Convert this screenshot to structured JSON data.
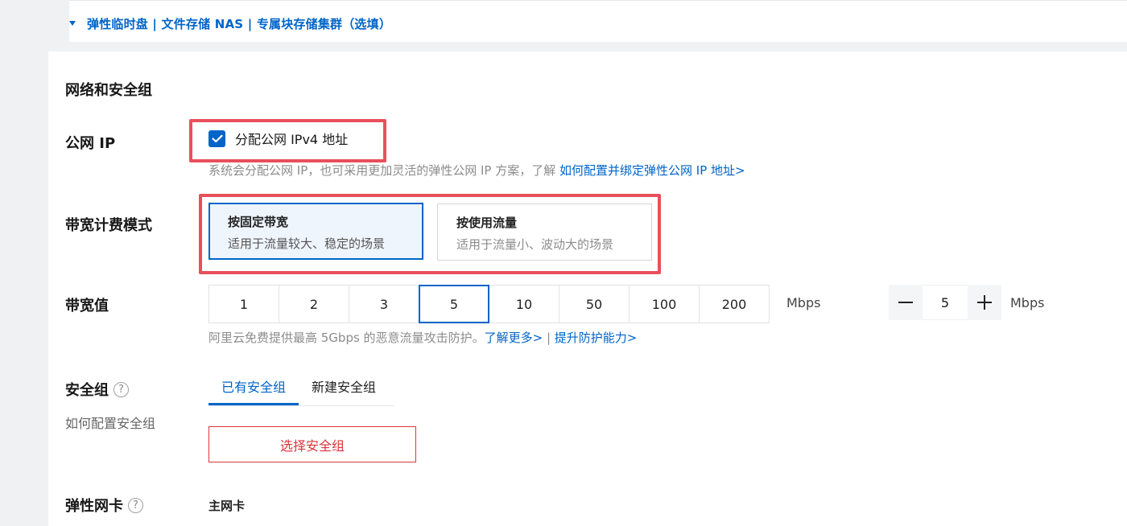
{
  "storage_toggle": {
    "label": "弹性临时盘 | 文件存储 NAS | 专属块存储集群（选填）"
  },
  "section_title": "网络和安全组",
  "public_ip": {
    "label": "公网 IP",
    "checkbox_label": "分配公网 IPv4 地址",
    "checked": true,
    "hint": "系统会分配公网 IP，也可采用更加灵活的弹性公网 IP 方案，了解",
    "hint_link": "如何配置并绑定弹性公网 IP 地址>"
  },
  "billing_mode": {
    "label": "带宽计费模式",
    "options": [
      {
        "title": "按固定带宽",
        "desc": "适用于流量较大、稳定的场景",
        "selected": true
      },
      {
        "title": "按使用流量",
        "desc": "适用于流量小、波动大的场景",
        "selected": false
      }
    ]
  },
  "bandwidth": {
    "label": "带宽值",
    "options": [
      "1",
      "2",
      "3",
      "5",
      "10",
      "50",
      "100",
      "200"
    ],
    "selected": "5",
    "unit": "Mbps",
    "stepper_value": "5",
    "stepper_unit": "Mbps",
    "hint": "阿里云免费提供最高 5Gbps 的恶意流量攻击防护。",
    "link_learn": "了解更多>",
    "separator": "|",
    "link_upgrade": "提升防护能力>"
  },
  "security_group": {
    "label": "安全组",
    "help": "?",
    "sublabel": "如何配置安全组",
    "tabs": [
      "已有安全组",
      "新建安全组"
    ],
    "active_tab": 0,
    "select_button": "选择安全组"
  },
  "eni": {
    "label": "弹性网卡",
    "help": "?",
    "primary": "主网卡"
  },
  "colors": {
    "accent": "#0064c8",
    "annotation": "#e8505b",
    "danger": "#d9363e"
  }
}
